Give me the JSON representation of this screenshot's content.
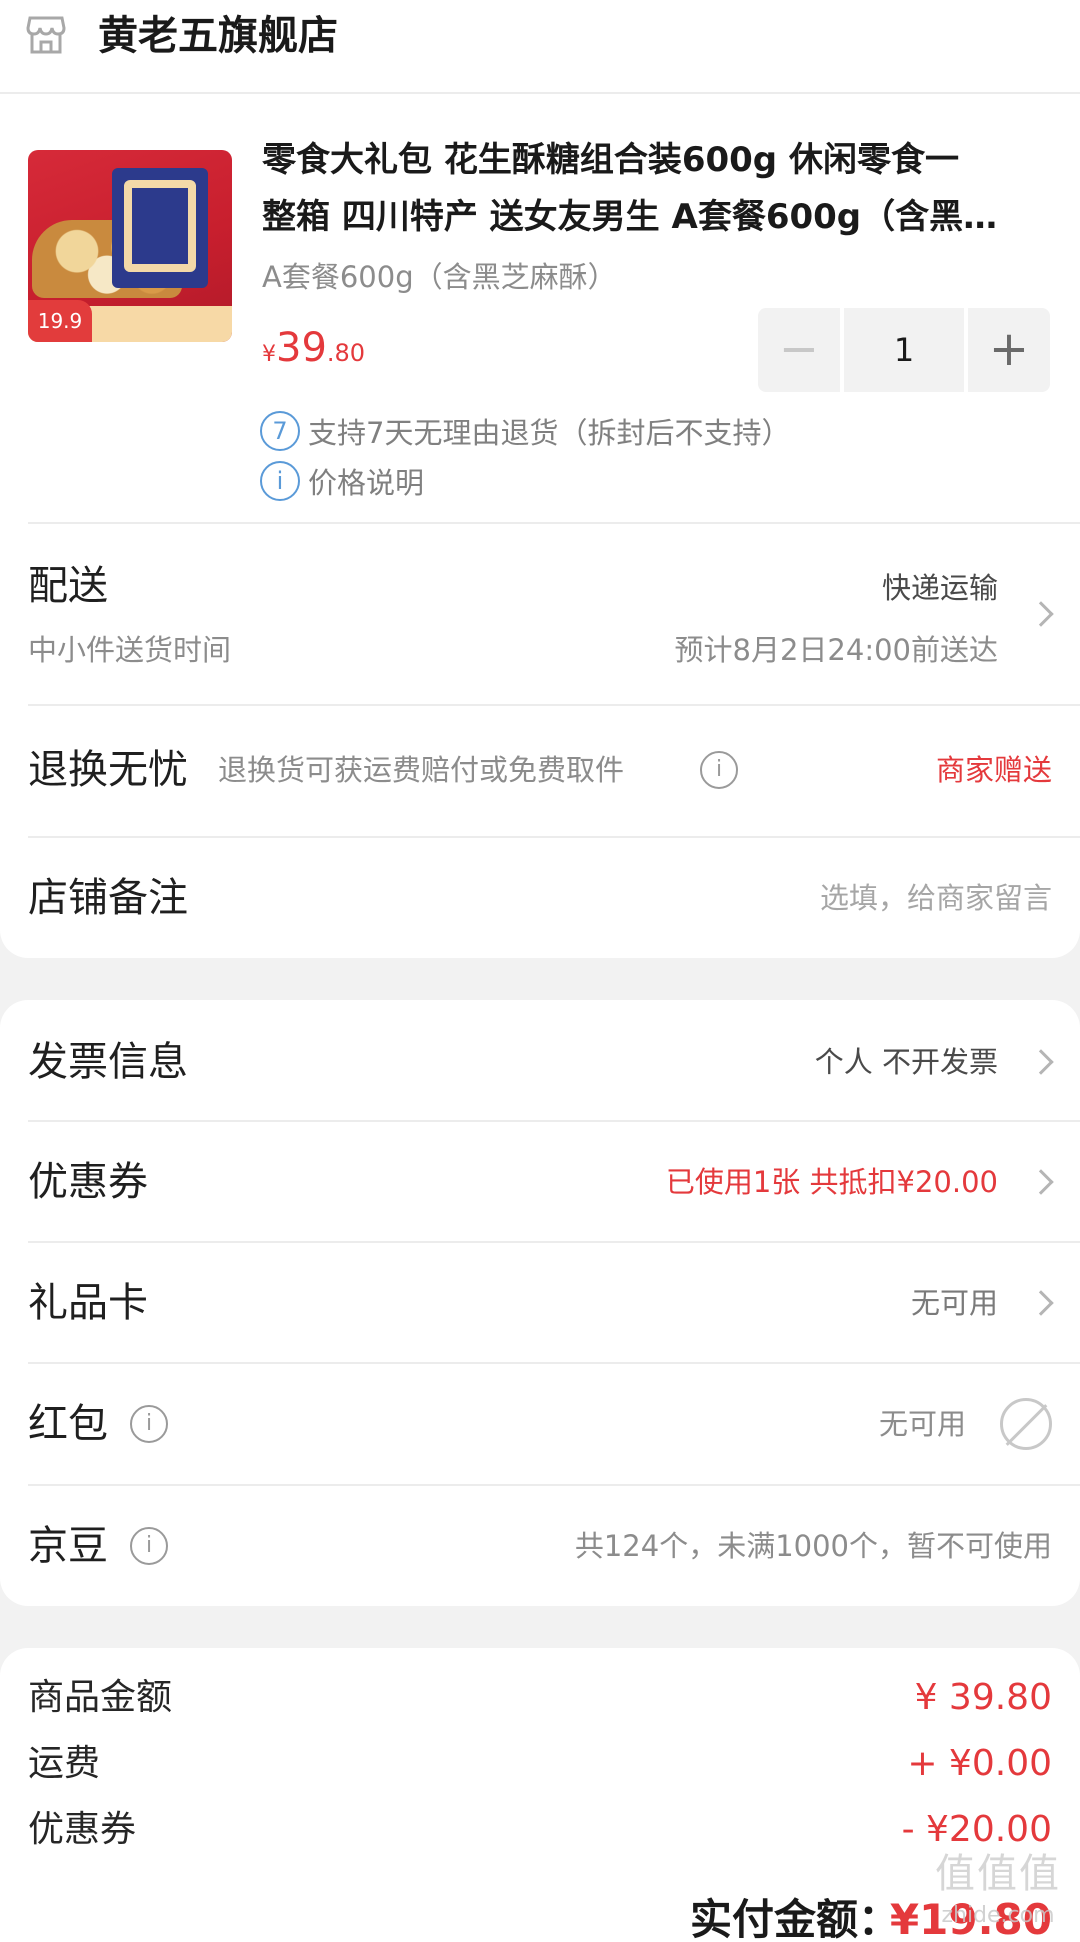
{
  "store": {
    "name": "黄老五旗舰店",
    "icon": "store-icon"
  },
  "product": {
    "title_line1": "零食大礼包 花生酥糖组合装600g 休闲零食一",
    "title_line2": "整箱 四川特产 送女友男生 A套餐600g（含黑…",
    "variant": "A套餐600g（含黑芝麻酥）",
    "price_symbol": "¥",
    "price_int": "39",
    "price_dec": ".80",
    "quantity": "1",
    "image_badge": "19.9",
    "services": [
      {
        "icon": "7",
        "text": "支持7天无理由退货（拆封后不支持）"
      },
      {
        "icon": "i",
        "text": "价格说明"
      }
    ]
  },
  "delivery": {
    "label": "配送",
    "method": "快递运输",
    "sub_label": "中小件送货时间",
    "eta": "预计8月2日24:00前送达"
  },
  "returns": {
    "label": "退换无忧",
    "desc": "退换货可获运费赔付或免费取件",
    "value": "商家赠送"
  },
  "remark": {
    "label": "店铺备注",
    "placeholder": "选填，给商家留言"
  },
  "invoice": {
    "label": "发票信息",
    "value": "个人 不开发票"
  },
  "coupon": {
    "label": "优惠券",
    "value": "已使用1张 共抵扣¥20.00"
  },
  "giftcard": {
    "label": "礼品卡",
    "value": "无可用"
  },
  "redpacket": {
    "label": "红包",
    "value": "无可用"
  },
  "jingdou": {
    "label": "京豆",
    "value": "共124个，未满1000个，暂不可使用"
  },
  "summary": {
    "items": [
      {
        "label": "商品金额",
        "value": "¥ 39.80"
      },
      {
        "label": "运费",
        "value": "+ ¥0.00"
      },
      {
        "label": "优惠券",
        "value": "- ¥20.00"
      }
    ],
    "total_label": "实付金额：",
    "total_value": "¥19.80"
  },
  "watermark": {
    "glyphs": "值值值",
    "text": "zhide.com"
  },
  "colors": {
    "accent_red": "#e4393c",
    "info_blue": "#5a9ad8",
    "background": "#f2f2f2"
  }
}
